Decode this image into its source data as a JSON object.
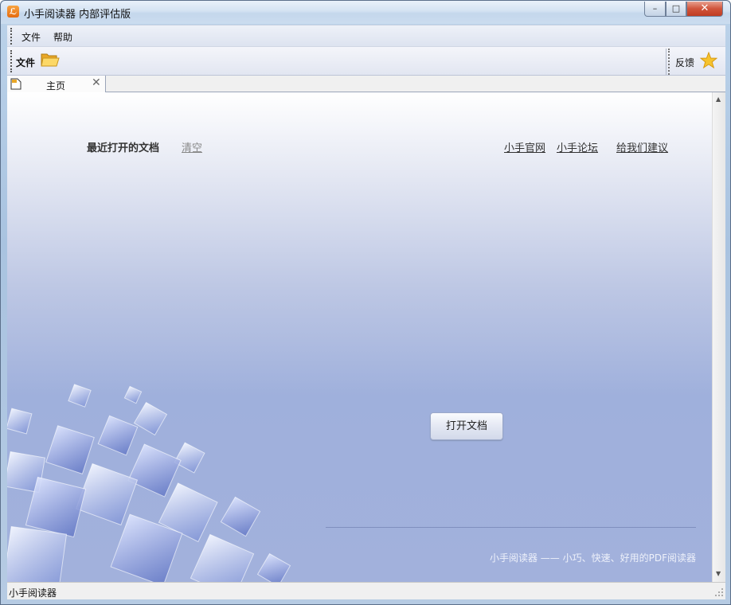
{
  "window": {
    "title": "小手阅读器 内部评估版",
    "controls": {
      "minimize": "–",
      "maximize": "□",
      "close": "✕"
    }
  },
  "menubar": {
    "items": [
      {
        "label": "文件"
      },
      {
        "label": "帮助"
      }
    ]
  },
  "toolbar": {
    "file_label": "文件",
    "file_icon": "folder-open-icon",
    "feedback_label": "反馈",
    "feedback_icon": "star-icon"
  },
  "tabs": [
    {
      "label": "主页",
      "icon": "document-icon",
      "close": "✕"
    }
  ],
  "home": {
    "recent_title": "最近打开的文档",
    "clear_link": "清空",
    "links": [
      "小手官网",
      "小手论坛",
      "给我们建议"
    ],
    "open_button": "打开文档",
    "tagline": "小手阅读器 —— 小巧、快速、好用的PDF阅读器"
  },
  "statusbar": {
    "text": "小手阅读器"
  }
}
